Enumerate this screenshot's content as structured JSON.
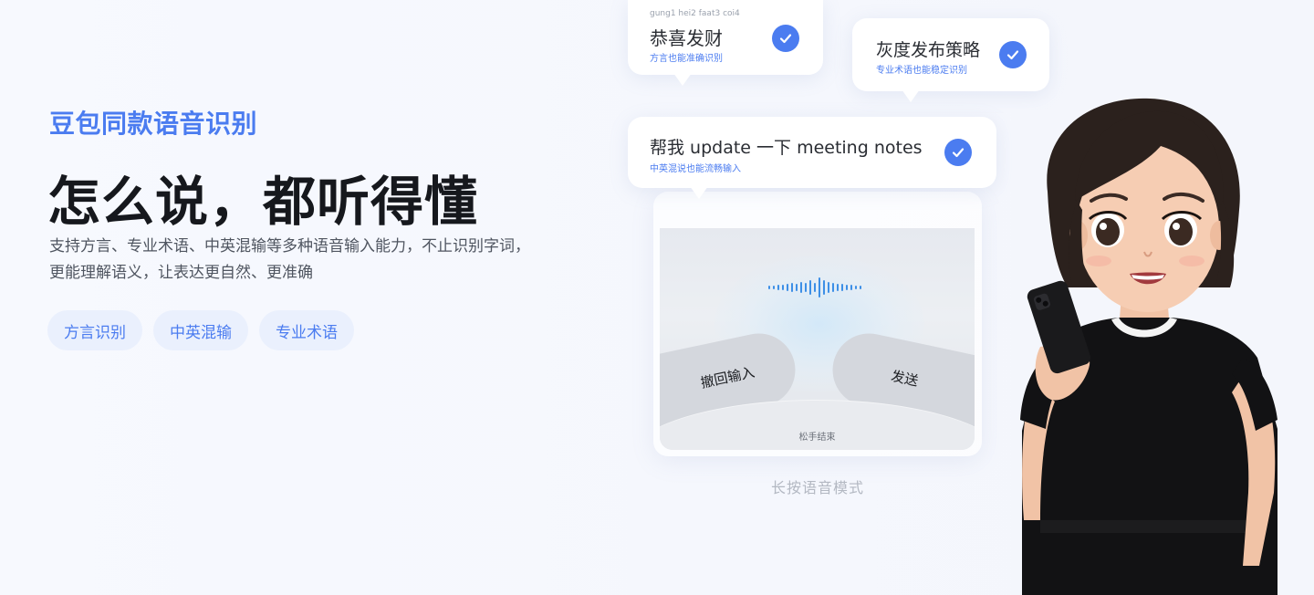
{
  "hero": {
    "eyebrow": "豆包同款语音识别",
    "headline": "怎么说，都听得懂",
    "description_line1": "支持方言、专业术语、中英混输等多种语音输入能力，不止识别字词，",
    "description_line2": "更能理解语义，让表达更自然、更准确",
    "tags": [
      "方言识别",
      "中英混输",
      "专业术语"
    ]
  },
  "bubbles": [
    {
      "phonetic": "gung1 hei2 faat3 coi4",
      "title": "恭喜发财",
      "subtitle": "方言也能准确识别"
    },
    {
      "title": "灰度发布策略",
      "subtitle": "专业术语也能稳定识别"
    },
    {
      "title": "帮我 update 一下 meeting notes",
      "subtitle": "中英混说也能流畅输入"
    }
  ],
  "voice_panel": {
    "cancel_label": "撤回输入",
    "send_label": "发送",
    "release_hint": "松手结束",
    "mode_caption": "长按语音模式"
  },
  "colors": {
    "accent": "#4b7cf0",
    "headline": "#16181d",
    "tag_bg": "#eaf0fd"
  },
  "icons": {
    "check": "check-circle-icon",
    "waveform": "voice-waveform-icon"
  }
}
